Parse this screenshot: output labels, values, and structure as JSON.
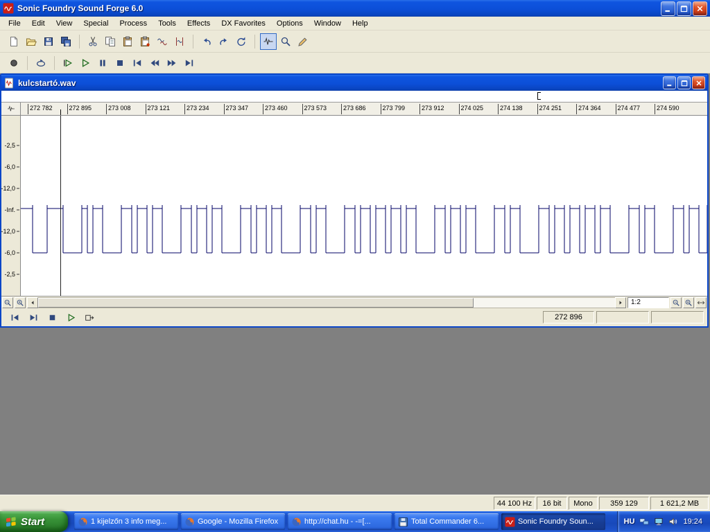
{
  "app": {
    "title": "Sonic Foundry Sound Forge 6.0",
    "menu": [
      "File",
      "Edit",
      "View",
      "Special",
      "Process",
      "Tools",
      "Effects",
      "DX Favorites",
      "Options",
      "Window",
      "Help"
    ],
    "toolbar_standard": [
      {
        "name": "new-file",
        "icon": "new-doc"
      },
      {
        "name": "open-file",
        "icon": "open-folder"
      },
      {
        "name": "save-file",
        "icon": "save"
      },
      {
        "name": "save-all",
        "icon": "save-all",
        "sep": true
      },
      {
        "name": "cut",
        "icon": "cut"
      },
      {
        "name": "copy",
        "icon": "copy"
      },
      {
        "name": "paste",
        "icon": "paste"
      },
      {
        "name": "paste-special",
        "icon": "paste-special"
      },
      {
        "name": "mix",
        "icon": "mix"
      },
      {
        "name": "trim",
        "icon": "trim",
        "sep": true
      },
      {
        "name": "undo",
        "icon": "undo"
      },
      {
        "name": "redo",
        "icon": "redo"
      },
      {
        "name": "repeat",
        "icon": "repeat",
        "sep": true
      },
      {
        "name": "edit-tool",
        "icon": "edit-tool",
        "pressed": true
      },
      {
        "name": "magnify-tool",
        "icon": "magnify"
      },
      {
        "name": "pencil-tool",
        "icon": "pencil"
      }
    ],
    "toolbar_transport": [
      {
        "name": "record",
        "icon": "record",
        "sep": true
      },
      {
        "name": "loop-playback",
        "icon": "loop",
        "sep": true
      },
      {
        "name": "play-all",
        "icon": "play-all"
      },
      {
        "name": "play",
        "icon": "play"
      },
      {
        "name": "pause",
        "icon": "pause"
      },
      {
        "name": "stop",
        "icon": "stop"
      },
      {
        "name": "go-to-start",
        "icon": "go-start"
      },
      {
        "name": "rewind",
        "icon": "rewind"
      },
      {
        "name": "forward",
        "icon": "forward"
      },
      {
        "name": "go-to-end",
        "icon": "go-end"
      }
    ]
  },
  "document": {
    "title": "kulcstartó.wav",
    "ruler_labels": [
      "272 782",
      "272 895",
      "273 008",
      "273 121",
      "273 234",
      "273 347",
      "273 460",
      "273 573",
      "273 686",
      "273 799",
      "273 912",
      "274 025",
      "274 138",
      "274 251",
      "274 364",
      "274 477",
      "274 590"
    ],
    "db_labels": [
      "-2,5",
      "-6,0",
      "-12,0",
      "-Inf.",
      "-12,0",
      "-6,0",
      "-2,5"
    ],
    "zoom_ratio": "1:2",
    "status_cells": [
      "272 896",
      "",
      ""
    ],
    "waveform": {
      "color": "#000066",
      "pulses": [
        [
          17,
          21
        ],
        [
          61,
          27
        ],
        [
          96,
          8
        ],
        [
          118,
          27
        ],
        [
          160,
          8
        ],
        [
          182,
          8
        ],
        [
          204,
          27
        ],
        [
          246,
          8
        ],
        [
          268,
          8
        ],
        [
          290,
          27
        ],
        [
          332,
          8
        ],
        [
          354,
          8
        ],
        [
          376,
          27
        ],
        [
          418,
          8
        ],
        [
          440,
          27
        ],
        [
          482,
          8
        ],
        [
          504,
          8
        ],
        [
          526,
          8
        ],
        [
          548,
          8
        ],
        [
          570,
          27
        ],
        [
          612,
          8
        ],
        [
          634,
          8
        ],
        [
          656,
          27
        ],
        [
          698,
          8
        ],
        [
          720,
          27
        ],
        [
          762,
          8
        ],
        [
          784,
          8
        ],
        [
          806,
          8
        ],
        [
          828,
          8
        ],
        [
          850,
          27
        ],
        [
          892,
          8
        ],
        [
          914,
          27
        ],
        [
          956,
          8
        ],
        [
          978,
          12
        ]
      ]
    }
  },
  "status_bar": {
    "fields": [
      "44 100 Hz",
      "16 bit",
      "Mono",
      "359 129",
      "1 621,2 MB"
    ]
  },
  "taskbar": {
    "start": "Start",
    "buttons": [
      {
        "label": "1 kijelzőn 3 info meg...",
        "icon": "firefox",
        "active": false
      },
      {
        "label": "Google - Mozilla Firefox",
        "icon": "firefox",
        "active": false
      },
      {
        "label": "http://chat.hu - -=[...",
        "icon": "firefox",
        "active": false
      },
      {
        "label": "Total Commander 6...",
        "icon": "tc",
        "active": false
      },
      {
        "label": "Sonic Foundry Soun...",
        "icon": "sf-logo",
        "active": true
      }
    ],
    "tray": {
      "language": "HU",
      "time": "19:24"
    }
  }
}
